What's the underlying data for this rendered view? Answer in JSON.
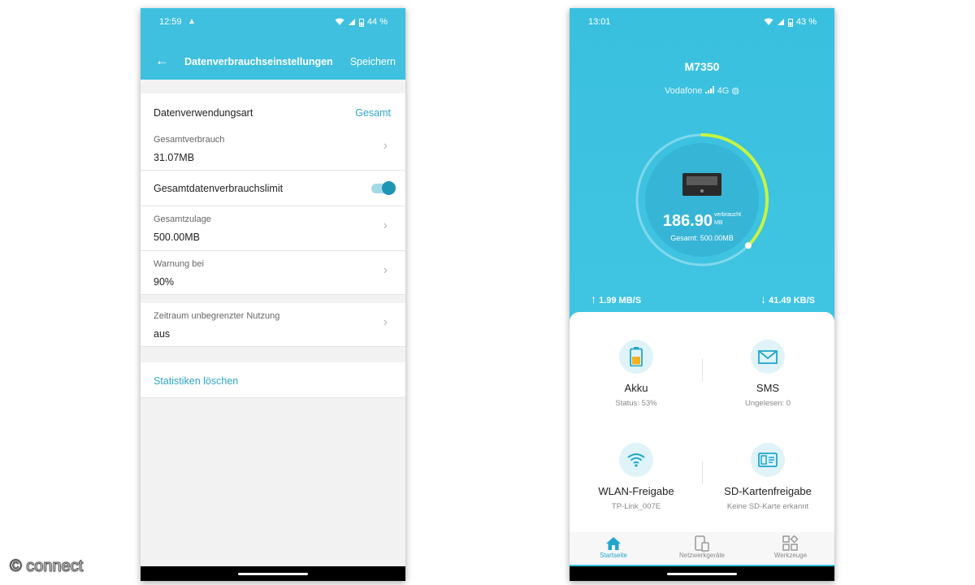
{
  "left": {
    "status": {
      "time": "12:59",
      "battery": "44 %"
    },
    "header": {
      "title": "Datenverbrauchseinstellungen",
      "save": "Speichern"
    },
    "rows": {
      "usage_type": {
        "label": "Datenverwendungsart",
        "value": "Gesamt"
      },
      "total_usage": {
        "label": "Gesamtverbrauch",
        "value": "31.07MB"
      },
      "limit": {
        "label": "Gesamtdatenverbrauchslimit",
        "enabled": true
      },
      "allowance": {
        "label": "Gesamtzulage",
        "value": "500.00MB"
      },
      "warning": {
        "label": "Warnung bei",
        "value": "90%"
      },
      "unlimited": {
        "label": "Zeitraum unbegrenzter Nutzung",
        "value": "aus"
      },
      "clear": {
        "label": "Statistiken löschen"
      }
    }
  },
  "right": {
    "status": {
      "time": "13:01",
      "battery": "43 %"
    },
    "device_name": "M7350",
    "carrier": "Vodafone",
    "network": "4G",
    "gauge": {
      "used_value": "186.90",
      "used_label": "verbraucht",
      "unit": "MB",
      "total_text": "Gesamt: 500.00MB",
      "used_mb": 186.9,
      "total_mb": 500
    },
    "upload": "1.99 MB/S",
    "download": "41.49 KB/S",
    "tiles": {
      "battery": {
        "title": "Akku",
        "subtitle": "Status: 53%"
      },
      "sms": {
        "title": "SMS",
        "subtitle": "Ungelesen: 0"
      },
      "wifi": {
        "title": "WLAN-Freigabe",
        "subtitle": "TP-Link_007E"
      },
      "sd": {
        "title": "SD-Kartenfreigabe",
        "subtitle": "Keine SD-Karte erkannt"
      }
    },
    "tabs": {
      "home": "Startseite",
      "devices": "Netzwerkgeräte",
      "tools": "Werkzeuge"
    }
  },
  "watermark": "© connect",
  "colors": {
    "accent": "#3fc0de",
    "link": "#2ea7c6",
    "gauge_arc": "#c6f53f",
    "battery": "#f5b21e"
  }
}
